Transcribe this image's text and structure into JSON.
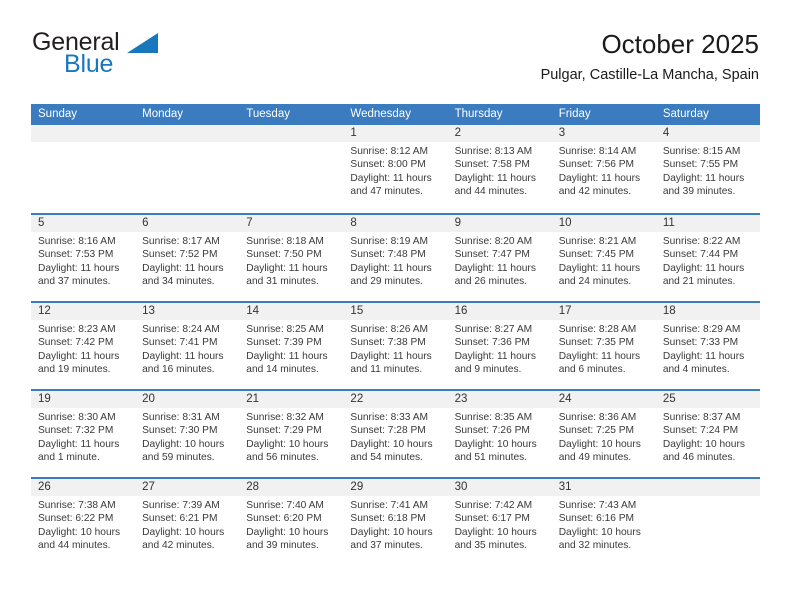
{
  "brand": {
    "name_part1": "General",
    "name_part2": "Blue",
    "accent_color": "#1878be"
  },
  "header": {
    "title": "October 2025",
    "subtitle": "Pulgar, Castille-La Mancha, Spain"
  },
  "theme": {
    "header_blue": "#3b7cc0",
    "day_band_gray": "#f1f1f1",
    "text_color": "#3a3a3a"
  },
  "weekdays": [
    "Sunday",
    "Monday",
    "Tuesday",
    "Wednesday",
    "Thursday",
    "Friday",
    "Saturday"
  ],
  "weeks": [
    [
      {
        "day": "",
        "empty": true
      },
      {
        "day": "",
        "empty": true
      },
      {
        "day": "",
        "empty": true
      },
      {
        "day": "1",
        "sunrise": "Sunrise: 8:12 AM",
        "sunset": "Sunset: 8:00 PM",
        "daylight": "Daylight: 11 hours and 47 minutes."
      },
      {
        "day": "2",
        "sunrise": "Sunrise: 8:13 AM",
        "sunset": "Sunset: 7:58 PM",
        "daylight": "Daylight: 11 hours and 44 minutes."
      },
      {
        "day": "3",
        "sunrise": "Sunrise: 8:14 AM",
        "sunset": "Sunset: 7:56 PM",
        "daylight": "Daylight: 11 hours and 42 minutes."
      },
      {
        "day": "4",
        "sunrise": "Sunrise: 8:15 AM",
        "sunset": "Sunset: 7:55 PM",
        "daylight": "Daylight: 11 hours and 39 minutes."
      }
    ],
    [
      {
        "day": "5",
        "sunrise": "Sunrise: 8:16 AM",
        "sunset": "Sunset: 7:53 PM",
        "daylight": "Daylight: 11 hours and 37 minutes."
      },
      {
        "day": "6",
        "sunrise": "Sunrise: 8:17 AM",
        "sunset": "Sunset: 7:52 PM",
        "daylight": "Daylight: 11 hours and 34 minutes."
      },
      {
        "day": "7",
        "sunrise": "Sunrise: 8:18 AM",
        "sunset": "Sunset: 7:50 PM",
        "daylight": "Daylight: 11 hours and 31 minutes."
      },
      {
        "day": "8",
        "sunrise": "Sunrise: 8:19 AM",
        "sunset": "Sunset: 7:48 PM",
        "daylight": "Daylight: 11 hours and 29 minutes."
      },
      {
        "day": "9",
        "sunrise": "Sunrise: 8:20 AM",
        "sunset": "Sunset: 7:47 PM",
        "daylight": "Daylight: 11 hours and 26 minutes."
      },
      {
        "day": "10",
        "sunrise": "Sunrise: 8:21 AM",
        "sunset": "Sunset: 7:45 PM",
        "daylight": "Daylight: 11 hours and 24 minutes."
      },
      {
        "day": "11",
        "sunrise": "Sunrise: 8:22 AM",
        "sunset": "Sunset: 7:44 PM",
        "daylight": "Daylight: 11 hours and 21 minutes."
      }
    ],
    [
      {
        "day": "12",
        "sunrise": "Sunrise: 8:23 AM",
        "sunset": "Sunset: 7:42 PM",
        "daylight": "Daylight: 11 hours and 19 minutes."
      },
      {
        "day": "13",
        "sunrise": "Sunrise: 8:24 AM",
        "sunset": "Sunset: 7:41 PM",
        "daylight": "Daylight: 11 hours and 16 minutes."
      },
      {
        "day": "14",
        "sunrise": "Sunrise: 8:25 AM",
        "sunset": "Sunset: 7:39 PM",
        "daylight": "Daylight: 11 hours and 14 minutes."
      },
      {
        "day": "15",
        "sunrise": "Sunrise: 8:26 AM",
        "sunset": "Sunset: 7:38 PM",
        "daylight": "Daylight: 11 hours and 11 minutes."
      },
      {
        "day": "16",
        "sunrise": "Sunrise: 8:27 AM",
        "sunset": "Sunset: 7:36 PM",
        "daylight": "Daylight: 11 hours and 9 minutes."
      },
      {
        "day": "17",
        "sunrise": "Sunrise: 8:28 AM",
        "sunset": "Sunset: 7:35 PM",
        "daylight": "Daylight: 11 hours and 6 minutes."
      },
      {
        "day": "18",
        "sunrise": "Sunrise: 8:29 AM",
        "sunset": "Sunset: 7:33 PM",
        "daylight": "Daylight: 11 hours and 4 minutes."
      }
    ],
    [
      {
        "day": "19",
        "sunrise": "Sunrise: 8:30 AM",
        "sunset": "Sunset: 7:32 PM",
        "daylight": "Daylight: 11 hours and 1 minute."
      },
      {
        "day": "20",
        "sunrise": "Sunrise: 8:31 AM",
        "sunset": "Sunset: 7:30 PM",
        "daylight": "Daylight: 10 hours and 59 minutes."
      },
      {
        "day": "21",
        "sunrise": "Sunrise: 8:32 AM",
        "sunset": "Sunset: 7:29 PM",
        "daylight": "Daylight: 10 hours and 56 minutes."
      },
      {
        "day": "22",
        "sunrise": "Sunrise: 8:33 AM",
        "sunset": "Sunset: 7:28 PM",
        "daylight": "Daylight: 10 hours and 54 minutes."
      },
      {
        "day": "23",
        "sunrise": "Sunrise: 8:35 AM",
        "sunset": "Sunset: 7:26 PM",
        "daylight": "Daylight: 10 hours and 51 minutes."
      },
      {
        "day": "24",
        "sunrise": "Sunrise: 8:36 AM",
        "sunset": "Sunset: 7:25 PM",
        "daylight": "Daylight: 10 hours and 49 minutes."
      },
      {
        "day": "25",
        "sunrise": "Sunrise: 8:37 AM",
        "sunset": "Sunset: 7:24 PM",
        "daylight": "Daylight: 10 hours and 46 minutes."
      }
    ],
    [
      {
        "day": "26",
        "sunrise": "Sunrise: 7:38 AM",
        "sunset": "Sunset: 6:22 PM",
        "daylight": "Daylight: 10 hours and 44 minutes."
      },
      {
        "day": "27",
        "sunrise": "Sunrise: 7:39 AM",
        "sunset": "Sunset: 6:21 PM",
        "daylight": "Daylight: 10 hours and 42 minutes."
      },
      {
        "day": "28",
        "sunrise": "Sunrise: 7:40 AM",
        "sunset": "Sunset: 6:20 PM",
        "daylight": "Daylight: 10 hours and 39 minutes."
      },
      {
        "day": "29",
        "sunrise": "Sunrise: 7:41 AM",
        "sunset": "Sunset: 6:18 PM",
        "daylight": "Daylight: 10 hours and 37 minutes."
      },
      {
        "day": "30",
        "sunrise": "Sunrise: 7:42 AM",
        "sunset": "Sunset: 6:17 PM",
        "daylight": "Daylight: 10 hours and 35 minutes."
      },
      {
        "day": "31",
        "sunrise": "Sunrise: 7:43 AM",
        "sunset": "Sunset: 6:16 PM",
        "daylight": "Daylight: 10 hours and 32 minutes."
      },
      {
        "day": "",
        "empty": true
      }
    ]
  ]
}
